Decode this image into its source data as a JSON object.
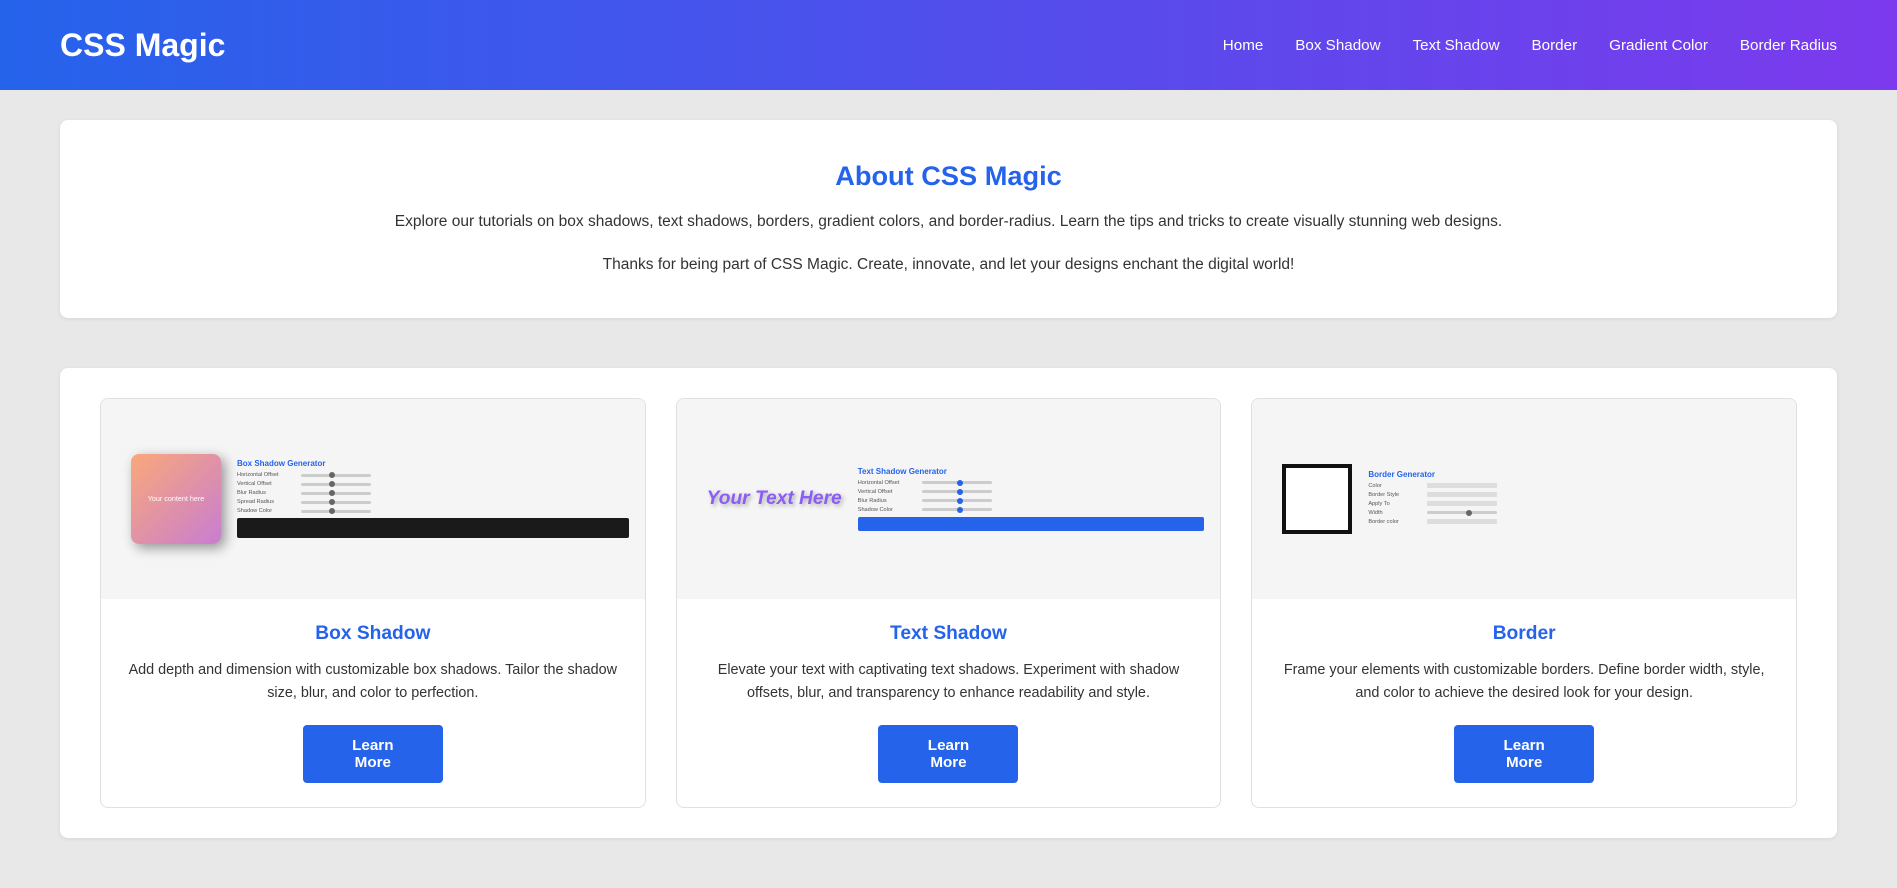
{
  "header": {
    "title": "CSS Magic",
    "nav": {
      "home": "Home",
      "boxShadow": "Box Shadow",
      "textShadow": "Text Shadow",
      "border": "Border",
      "gradientColor": "Gradient Color",
      "borderRadius": "Border Radius"
    }
  },
  "about": {
    "title": "About CSS Magic",
    "description": "Explore our tutorials on box shadows, text shadows, borders, gradient colors, and border-radius. Learn the tips and tricks to create visually stunning web designs.",
    "thanks": "Thanks for being part of CSS Magic. Create, innovate, and let your designs enchant the digital world!"
  },
  "cards": [
    {
      "id": "box-shadow",
      "title": "Box Shadow",
      "description": "Add depth and dimension with customizable box shadows. Tailor the shadow size, blur, and color to perfection.",
      "learnMore": "Learn More",
      "previewText": "Your content here",
      "formTitle": "Box Shadow Generator"
    },
    {
      "id": "text-shadow",
      "title": "Text Shadow",
      "description": "Elevate your text with captivating text shadows. Experiment with shadow offsets, blur, and transparency to enhance readability and style.",
      "learnMore": "Learn More",
      "previewText": "Your Text Here",
      "formTitle": "Text Shadow Generator"
    },
    {
      "id": "border",
      "title": "Border",
      "description": "Frame your elements with customizable borders. Define border width, style, and color to achieve the desired look for your design.",
      "learnMore": "Learn More",
      "formTitle": "Border Generator"
    }
  ]
}
